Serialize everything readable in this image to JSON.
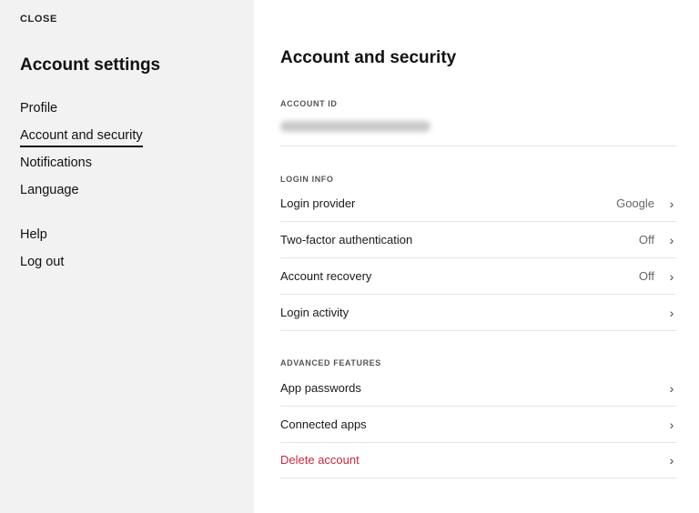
{
  "sidebar": {
    "close": "CLOSE",
    "title": "Account settings",
    "items": [
      "Profile",
      "Account and security",
      "Notifications",
      "Language"
    ],
    "secondary": [
      "Help",
      "Log out"
    ]
  },
  "main": {
    "title": "Account and security",
    "account_id_label": "ACCOUNT ID",
    "login_info_label": "LOGIN INFO",
    "login_rows": [
      {
        "label": "Login provider",
        "value": "Google"
      },
      {
        "label": "Two-factor authentication",
        "value": "Off"
      },
      {
        "label": "Account recovery",
        "value": "Off"
      },
      {
        "label": "Login activity",
        "value": ""
      }
    ],
    "advanced_label": "ADVANCED FEATURES",
    "advanced_rows": [
      {
        "label": "App passwords"
      },
      {
        "label": "Connected apps"
      },
      {
        "label": "Delete account"
      }
    ],
    "danger_color": "#c8283c"
  }
}
